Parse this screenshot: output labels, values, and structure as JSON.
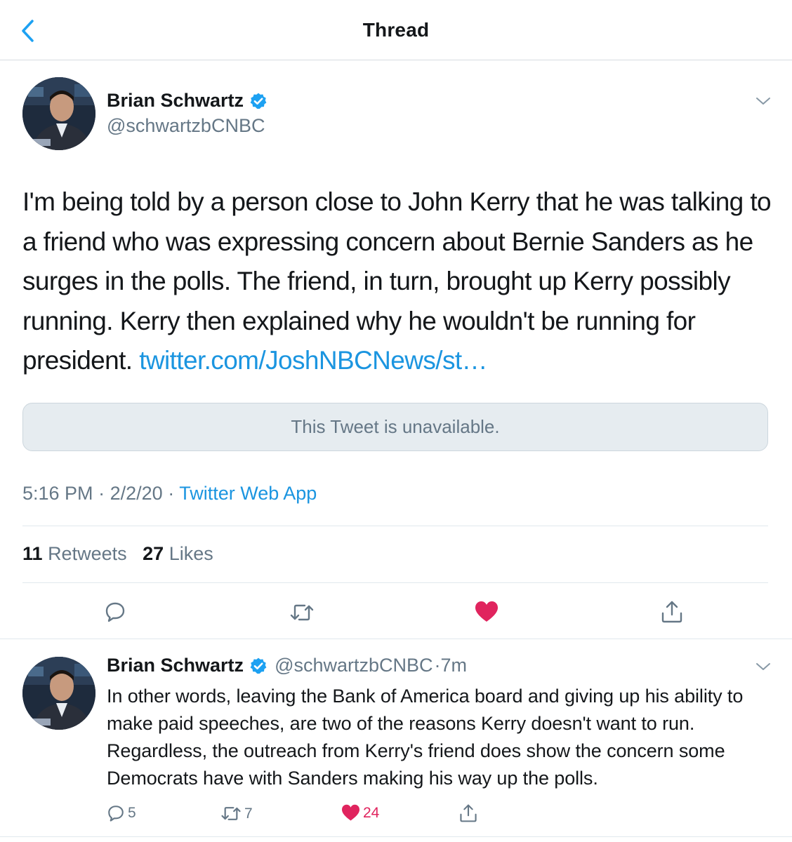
{
  "header": {
    "title": "Thread"
  },
  "main_tweet": {
    "author_name": "Brian Schwartz",
    "author_handle": "@schwartzbCNBC",
    "text": "I'm being told by a person close to John Kerry that he was talking to a friend who was expressing concern about Bernie Sanders as he surges in the polls. The friend, in turn, brought up Kerry possibly running. Kerry then explained why he wouldn't be running for president.",
    "link": "twitter.com/JoshNBCNews/st…",
    "quoted_unavailable": "This Tweet is unavailable.",
    "time": "5:16 PM",
    "date": "2/2/20",
    "separator": "·",
    "source": "Twitter Web App",
    "retweets_count": "11",
    "retweets_label": "Retweets",
    "likes_count": "27",
    "likes_label": "Likes"
  },
  "reply_tweet": {
    "author_name": "Brian Schwartz",
    "author_handle": "@schwartzbCNBC",
    "age": "·7m",
    "text": "In other words, leaving the Bank of America board and giving up his ability to make paid speeches, are two of the reasons Kerry doesn't want to run. Regardless, the outreach from Kerry's friend does show the concern some Democrats have with Sanders making his way up the polls.",
    "reply_count": "5",
    "retweet_count": "7",
    "like_count": "24"
  },
  "icons": {
    "back": "chevron-left-icon",
    "verified": "verified-badge-icon",
    "caret": "chevron-down-icon",
    "reply": "reply-icon",
    "retweet": "retweet-icon",
    "like": "heart-icon",
    "share": "share-icon"
  },
  "colors": {
    "accent": "#1b95e0",
    "like": "#e0245e",
    "secondary_text": "#657786",
    "primary_text": "#14171a",
    "verified": "#1da1f2"
  }
}
